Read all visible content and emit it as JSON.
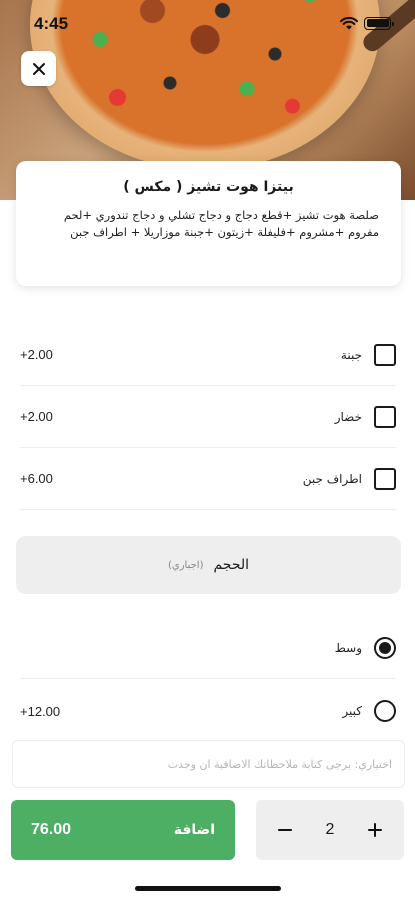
{
  "status_bar": {
    "time": "4:45"
  },
  "item": {
    "title": "بيتزا هوت تشيز ( مكس )",
    "description": "صلصة هوت تشيز +قطع دجاج و دجاج تشلي و دجاج تندوري +لحم مفروم +مشروم +فليفلة +زيتون +جبنة موزاريلا + اطراف جبن"
  },
  "addons": [
    {
      "label": "جبنة",
      "price": "+2.00",
      "checked": false
    },
    {
      "label": "خضار",
      "price": "+2.00",
      "checked": false
    },
    {
      "label": "اطراف جبن",
      "price": "+6.00",
      "checked": false
    }
  ],
  "size_section": {
    "title": "الحجم",
    "required": "(اجباري)"
  },
  "sizes": [
    {
      "label": "وسط",
      "price": "",
      "selected": true
    },
    {
      "label": "كبير",
      "price": "+12.00",
      "selected": false
    }
  ],
  "notes": {
    "placeholder": "اختياري: يرجى كتابة ملاحظاتك الاضافية ان وجدت",
    "value": ""
  },
  "footer": {
    "add_label": "اضافة",
    "total": "76.00",
    "quantity": "2"
  },
  "icons": {
    "close": "close-icon",
    "minus": "minus-icon",
    "plus": "plus-icon",
    "wifi": "wifi-icon",
    "battery": "battery-icon"
  },
  "colors": {
    "accent": "#4caf63",
    "section_bg": "#eeeeee"
  }
}
